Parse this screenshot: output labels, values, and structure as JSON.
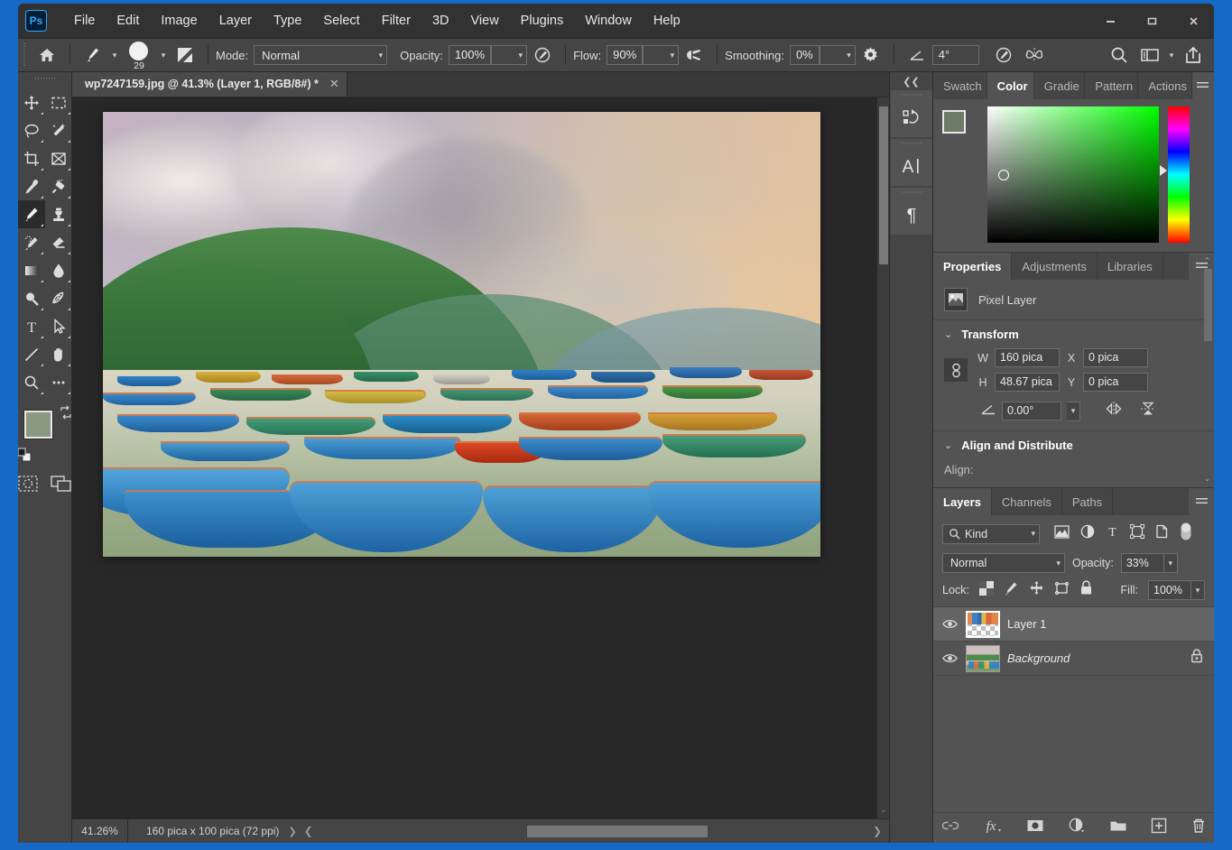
{
  "app": {
    "name": "Adobe Photoshop",
    "logo_text": "Ps"
  },
  "menubar": {
    "items": [
      "File",
      "Edit",
      "Image",
      "Layer",
      "Type",
      "Select",
      "Filter",
      "3D",
      "View",
      "Plugins",
      "Window",
      "Help"
    ]
  },
  "window_controls": {
    "minimize": "minimize-icon",
    "maximize": "maximize-icon",
    "close": "close-icon"
  },
  "options_bar": {
    "home_icon": "home-icon",
    "brush_preset_icon": "brush-preset-icon",
    "brush_size": "29",
    "brush_panel_icon": "brush-settings-panel-icon",
    "mode_label": "Mode:",
    "mode_value": "Normal",
    "opacity_label": "Opacity:",
    "opacity_value": "100%",
    "opacity_pressure_icon": "pressure-opacity-icon",
    "flow_label": "Flow:",
    "flow_value": "90%",
    "airbrush_icon": "airbrush-icon",
    "smoothing_label": "Smoothing:",
    "smoothing_value": "0%",
    "smoothing_options_icon": "gear-icon",
    "angle_icon": "angle-icon",
    "angle_value": "4°",
    "pressure_size_icon": "pressure-size-icon",
    "symmetry_icon": "symmetry-butterfly-icon",
    "search_icon": "search-icon",
    "workspace_icon": "workspace-icon",
    "share_icon": "share-icon"
  },
  "toolbar": {
    "tools": [
      {
        "name": "move-tool",
        "icon": "move-icon",
        "active": false
      },
      {
        "name": "rectangular-marquee-tool",
        "icon": "marquee-icon",
        "active": false
      },
      {
        "name": "lasso-tool",
        "icon": "lasso-icon",
        "active": false
      },
      {
        "name": "object-selection-tool",
        "icon": "magic-wand-icon",
        "active": false
      },
      {
        "name": "crop-tool",
        "icon": "crop-icon",
        "active": false
      },
      {
        "name": "frame-tool",
        "icon": "frame-icon",
        "active": false
      },
      {
        "name": "eyedropper-tool",
        "icon": "eyedropper-icon",
        "active": false
      },
      {
        "name": "spot-healing-brush-tool",
        "icon": "healing-brush-icon",
        "active": false
      },
      {
        "name": "brush-tool",
        "icon": "brush-icon",
        "active": true
      },
      {
        "name": "clone-stamp-tool",
        "icon": "stamp-icon",
        "active": false
      },
      {
        "name": "history-brush-tool",
        "icon": "history-brush-icon",
        "active": false
      },
      {
        "name": "eraser-tool",
        "icon": "eraser-icon",
        "active": false
      },
      {
        "name": "gradient-tool",
        "icon": "gradient-icon",
        "active": false
      },
      {
        "name": "blur-tool",
        "icon": "blur-drop-icon",
        "active": false
      },
      {
        "name": "dodge-tool",
        "icon": "dodge-icon",
        "active": false
      },
      {
        "name": "pen-tool",
        "icon": "pen-icon",
        "active": false
      },
      {
        "name": "type-tool",
        "icon": "type-t-icon",
        "active": false
      },
      {
        "name": "path-selection-tool",
        "icon": "path-arrow-icon",
        "active": false
      },
      {
        "name": "line-tool",
        "icon": "line-icon",
        "active": false
      },
      {
        "name": "hand-tool",
        "icon": "hand-icon",
        "active": false
      },
      {
        "name": "zoom-tool",
        "icon": "zoom-magnifier-icon",
        "active": false
      },
      {
        "name": "edit-toolbar-tool",
        "icon": "ellipsis-icon",
        "active": false
      }
    ],
    "foreground_color": "#8a9a82",
    "background_color": "#b3c1d1",
    "swap_icon": "swap-colors-icon",
    "default_colors_icon": "default-colors-icon",
    "quick_mask_icon": "quick-mask-icon",
    "screen_mode_icon": "screen-mode-icon"
  },
  "document": {
    "tab_title": "wp7247159.jpg @ 41.3% (Layer 1, RGB/8#) *",
    "close_icon": "close-tab-icon"
  },
  "status_bar": {
    "zoom": "41.26%",
    "doc_size": "160 pica x 100 pica (72 ppi)",
    "expand_icon": "chevron-right-icon",
    "scroll_left_icon": "chevron-left-icon",
    "scroll_right_icon": "chevron-right-icon"
  },
  "mini_dock": {
    "collapse_icon": "collapse-panels-icon",
    "buttons": [
      {
        "name": "history-panel-button",
        "icon": "history-icon"
      },
      {
        "name": "character-panel-button",
        "icon": "character-a-icon"
      },
      {
        "name": "paragraph-panel-button",
        "icon": "paragraph-pilcrow-icon"
      }
    ]
  },
  "color_panel": {
    "tabs": [
      {
        "label": "Swatch",
        "active": false
      },
      {
        "label": "Color",
        "active": true
      },
      {
        "label": "Gradie",
        "active": false
      },
      {
        "label": "Pattern",
        "active": false
      },
      {
        "label": "Actions",
        "active": false
      }
    ],
    "menu_icon": "panel-menu-icon",
    "foreground_color": "#6e7a68",
    "background_color": "#b3c1d1",
    "picker_icon": "color-field-picker",
    "hue_slider_icon": "hue-slider"
  },
  "properties_panel": {
    "tabs": [
      {
        "label": "Properties",
        "active": true
      },
      {
        "label": "Adjustments",
        "active": false
      },
      {
        "label": "Libraries",
        "active": false
      }
    ],
    "menu_icon": "panel-menu-icon",
    "layer_type_icon": "pixel-layer-thumbnail-icon",
    "layer_type": "Pixel Layer",
    "transform": {
      "section_label": "Transform",
      "collapse_icon": "chevron-down-icon",
      "link_icon": "link-wh-icon",
      "w_label": "W",
      "w_value": "160 pica",
      "h_label": "H",
      "h_value": "48.67 pica",
      "x_label": "X",
      "x_value": "0 pica",
      "y_label": "Y",
      "y_value": "0 pica",
      "angle_icon": "angle-icon",
      "angle_value": "0.00°",
      "flip_horizontal_icon": "flip-horizontal-icon",
      "flip_vertical_icon": "flip-vertical-icon"
    },
    "align": {
      "section_label": "Align and Distribute",
      "collapse_icon": "chevron-down-icon",
      "align_label": "Align:"
    },
    "scroll_up_icon": "chevron-up-icon",
    "scroll_down_icon": "chevron-down-icon"
  },
  "layers_panel": {
    "tabs": [
      {
        "label": "Layers",
        "active": true
      },
      {
        "label": "Channels",
        "active": false
      },
      {
        "label": "Paths",
        "active": false
      }
    ],
    "menu_icon": "panel-menu-icon",
    "filter_kind_label": "Kind",
    "filter_search_icon": "search-icon",
    "filter_icons": [
      "filter-pixel-icon",
      "filter-adjustment-icon",
      "filter-type-icon",
      "filter-shape-icon",
      "filter-smart-object-icon",
      "filter-toggle-icon"
    ],
    "blend_mode": "Normal",
    "opacity_label": "Opacity:",
    "opacity_value": "33%",
    "lock_label": "Lock:",
    "lock_icons": [
      "lock-transparent-pixels-icon",
      "lock-image-pixels-icon",
      "lock-position-icon",
      "lock-artboard-icon",
      "lock-all-icon"
    ],
    "fill_label": "Fill:",
    "fill_value": "100%",
    "layers": [
      {
        "name": "Layer 1",
        "selected": true,
        "visible": true,
        "locked": false,
        "italic": false,
        "thumb": "transparent-colorful-thumb"
      },
      {
        "name": "Background",
        "selected": false,
        "visible": true,
        "locked": true,
        "italic": true,
        "thumb": "photo-thumb"
      }
    ],
    "bottom_icons": [
      "link-layers-icon",
      "layer-style-fx-icon",
      "add-layer-mask-icon",
      "new-adjustment-layer-icon",
      "new-group-icon",
      "new-layer-icon",
      "delete-layer-icon"
    ]
  },
  "canvas": {
    "image_name": "wp7247159.jpg",
    "description": "Colorful wooden rowing boats moored on a misty lake below green hills",
    "vertical_scrollbar": "canvas-vertical-scrollbar",
    "horizontal_scrollbar": "canvas-horizontal-scrollbar"
  }
}
